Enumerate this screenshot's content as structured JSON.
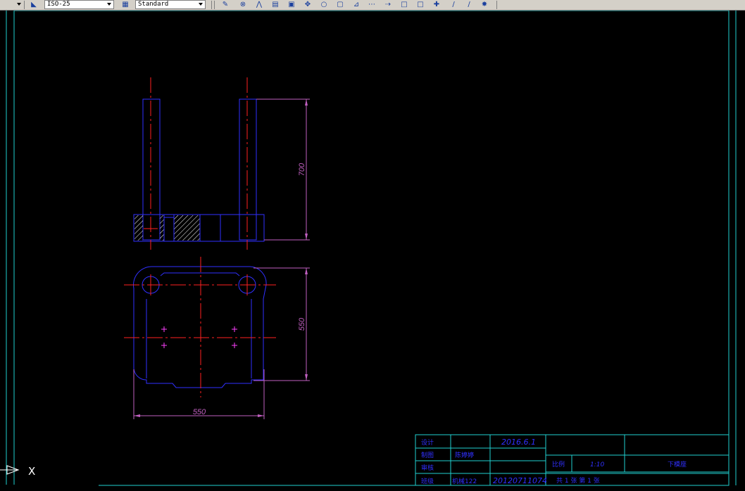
{
  "toolbar": {
    "dimstyle_value": "ISO-25",
    "tablestyle_value": "Standard",
    "icons": [
      "dim-style-icon",
      "table-style-icon",
      "pencil-icon",
      "link-icon",
      "mirror-icon",
      "copy-icon",
      "array-icon",
      "move-icon",
      "rotate-icon",
      "scale-icon",
      "stretch-icon",
      "trim-icon",
      "extend-icon",
      "break-icon",
      "join-icon",
      "chamfer-icon",
      "fillet-icon",
      "explode-icon"
    ]
  },
  "drawing": {
    "dim_height_top": "700",
    "dim_height_bottom": "550",
    "dim_width_bottom": "550",
    "ucs_x_label": "X"
  },
  "title_block": {
    "design_label": "设计",
    "design_date": "2016.6.1",
    "drawn_label": "制图",
    "drawn_name": "陈婷婷",
    "check_label": "审核",
    "approve_label": "班级",
    "class_value": "机械122",
    "id_value": "20120711074",
    "scale_label": "比例",
    "scale_value": "1:10",
    "part_name": "下模座",
    "sheet_info": "共 1 张  第 1 张"
  },
  "colors": {
    "background": "#000000",
    "object_line": "#3030ff",
    "center_line": "#ff2020",
    "dimension": "#c060c0",
    "border": "#20d0d0",
    "hatch": "#ffffff",
    "toolbar": "#d4d0c8"
  }
}
